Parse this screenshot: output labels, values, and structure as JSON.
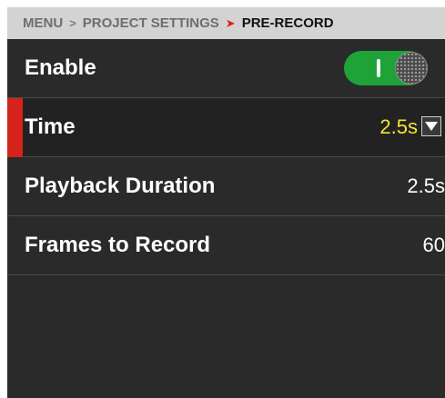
{
  "breadcrumb": {
    "items": [
      "MENU",
      "PROJECT SETTINGS"
    ],
    "current": "PRE-RECORD",
    "separator": ">",
    "separator_active": "➤"
  },
  "settings": {
    "enable": {
      "label": "Enable",
      "state": "on"
    },
    "time": {
      "label": "Time",
      "value": "2.5s",
      "selected": true
    },
    "playback_duration": {
      "label": "Playback Duration",
      "value": "2.5s"
    },
    "frames_to_record": {
      "label": "Frames to Record",
      "value": "60"
    }
  },
  "colors": {
    "accent_red": "#d4231b",
    "toggle_on": "#1fa339",
    "value_highlight": "#f3e534",
    "background": "#2a2a2a"
  }
}
